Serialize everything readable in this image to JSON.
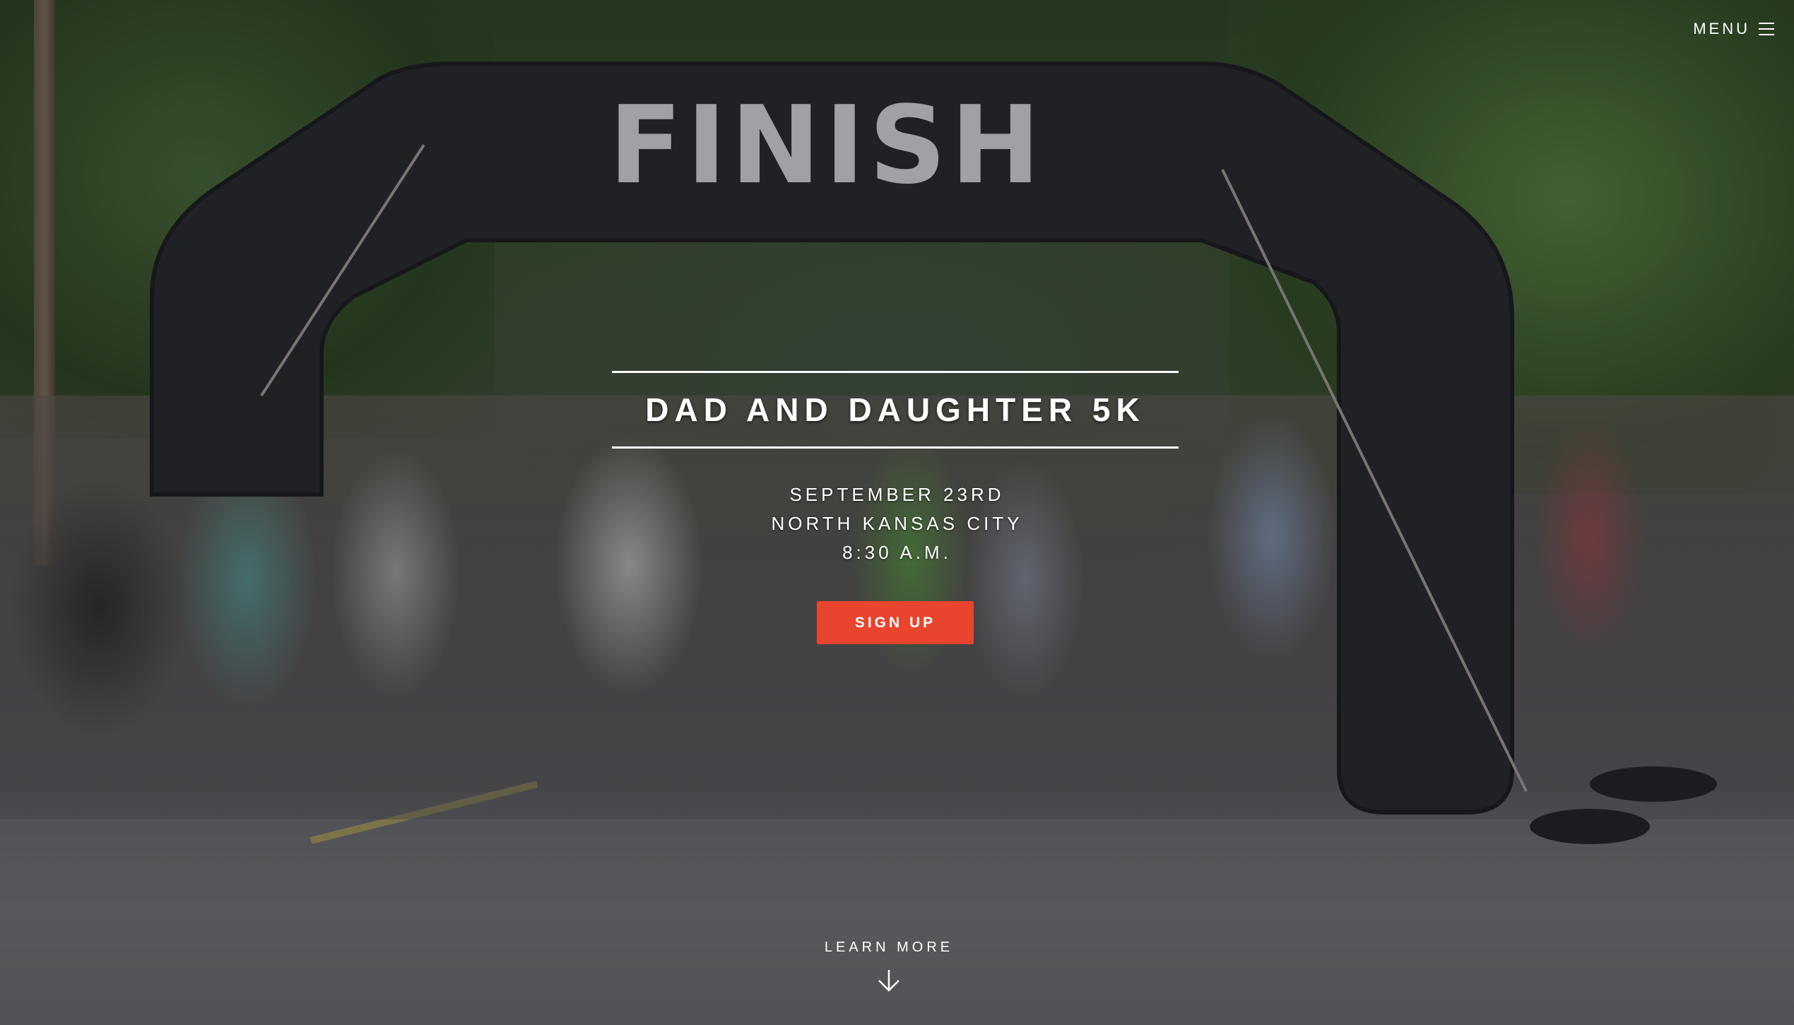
{
  "nav": {
    "menu_label": "MENU",
    "menu_icon": "hamburger-icon"
  },
  "hero": {
    "background_image": "finish-arch",
    "arch_text": "FINISH",
    "title": "DAD AND DAUGHTER 5K",
    "date": "SEPTEMBER 23RD",
    "location": "NORTH KANSAS CITY",
    "time": "8:30 A.M.",
    "cta_label": "SIGN UP",
    "cta_color": "#e9442e",
    "learn_more_label": "LEARN MORE",
    "learn_more_icon": "arrow-down-icon"
  }
}
